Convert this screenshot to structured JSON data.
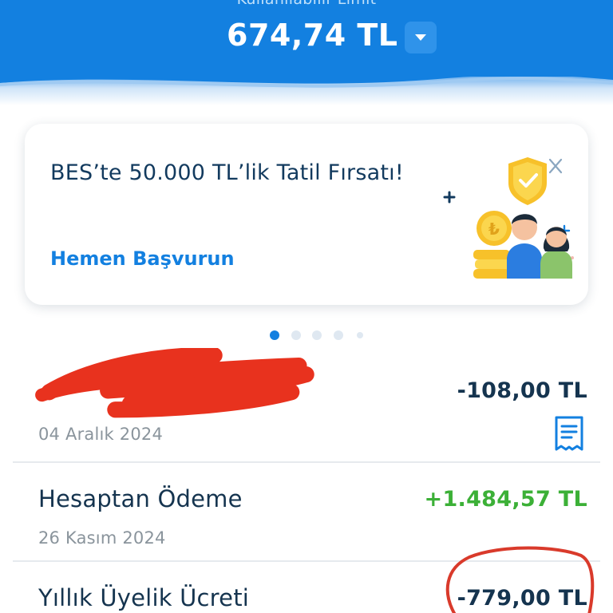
{
  "header": {
    "limit_label": "Kullanılabilir Limit",
    "limit_amount": "674,74 TL",
    "toggle_icon": "chevron-down-icon"
  },
  "promo": {
    "title": "BES’te 50.000 TL’lik Tatil Fırsatı!",
    "cta": "Hemen Başvurun",
    "close_icon": "close-icon",
    "illustration": "couple-with-coins-and-shield-illustration"
  },
  "pager": {
    "count": 5,
    "active_index": 0
  },
  "transactions": [
    {
      "name": "",
      "amount": "-108,00 TL",
      "date": "04 Aralık 2024",
      "icon": "receipt-icon"
    },
    {
      "name": "Hesaptan Ödeme",
      "amount": "+1.484,57 TL",
      "date": "26 Kasım 2024"
    },
    {
      "name": "Yıllık Üyelik Ücreti",
      "amount": "-779,00 TL"
    }
  ],
  "colors": {
    "brand_blue": "#1380e0",
    "text_dark": "#15344f",
    "positive_green": "#3cb037",
    "redaction_red": "#e8321e",
    "circle_annotation": "#d93a2b"
  }
}
